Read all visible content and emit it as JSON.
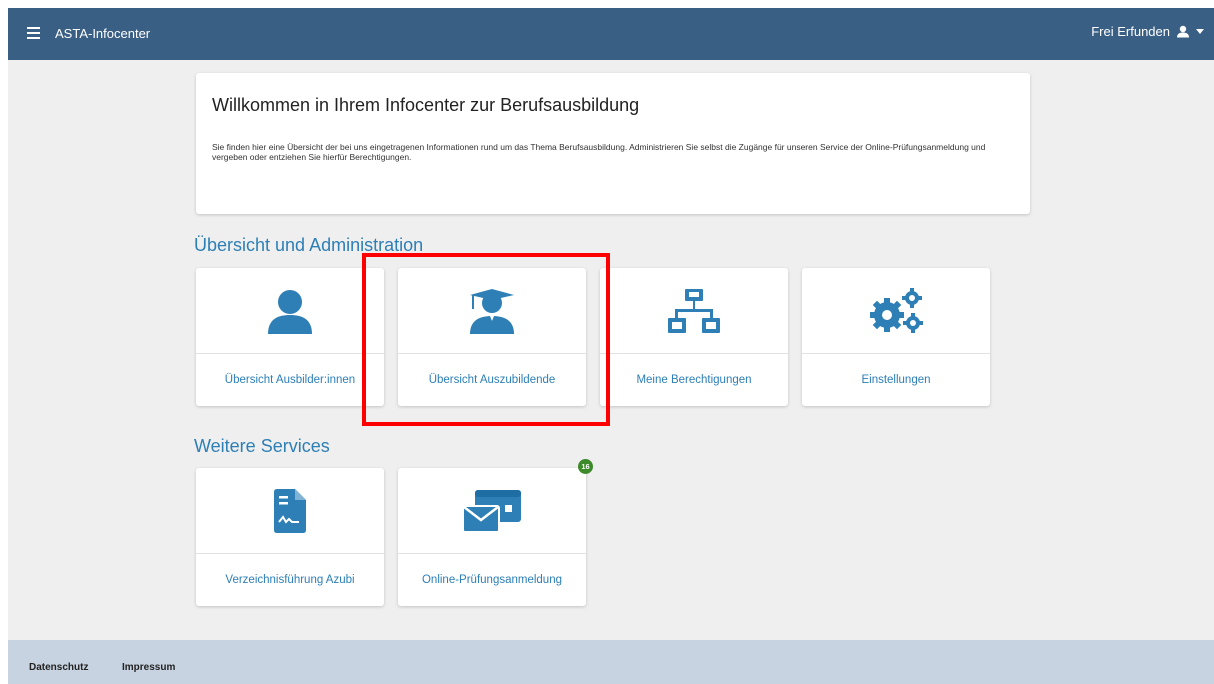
{
  "header": {
    "app_title": "ASTA-Infocenter",
    "user_name": "Frei Erfunden",
    "menu_icon": "hamburger-icon",
    "user_icon": "user-icon",
    "color": "#3a5f85"
  },
  "welcome": {
    "title": "Willkommen in Ihrem Infocenter zur Berufsausbildung",
    "text": "Sie finden hier eine Übersicht der bei uns eingetragenen Informationen rund um das Thema Berufsausbildung. Administrieren Sie selbst die Zugänge für unseren Service der Online-Prüfungsanmeldung und vergeben oder entziehen Sie hierfür Berechtigungen."
  },
  "sections": {
    "admin": {
      "title": "Übersicht und Administration",
      "tiles": [
        {
          "label": "Übersicht Ausbilder:innen",
          "icon": "person-icon"
        },
        {
          "label": "Übersicht Auszubildende",
          "icon": "graduate-icon"
        },
        {
          "label": "Meine Berechtigungen",
          "icon": "network-icon"
        },
        {
          "label": "Einstellungen",
          "icon": "gears-icon"
        }
      ]
    },
    "services": {
      "title": "Weitere Services",
      "tiles": [
        {
          "label": "Verzeichnisführung Azubi",
          "icon": "document-signature-icon"
        },
        {
          "label": "Online-Prüfungsanmeldung",
          "icon": "envelope-window-icon",
          "badge": "16"
        }
      ]
    }
  },
  "footer": {
    "links": [
      "Datenschutz",
      "Impressum"
    ]
  },
  "colors": {
    "accent": "#2d7fb5",
    "badge": "#3d8a2b",
    "highlight": "#ff0000",
    "footer": "#c7d3e0"
  }
}
